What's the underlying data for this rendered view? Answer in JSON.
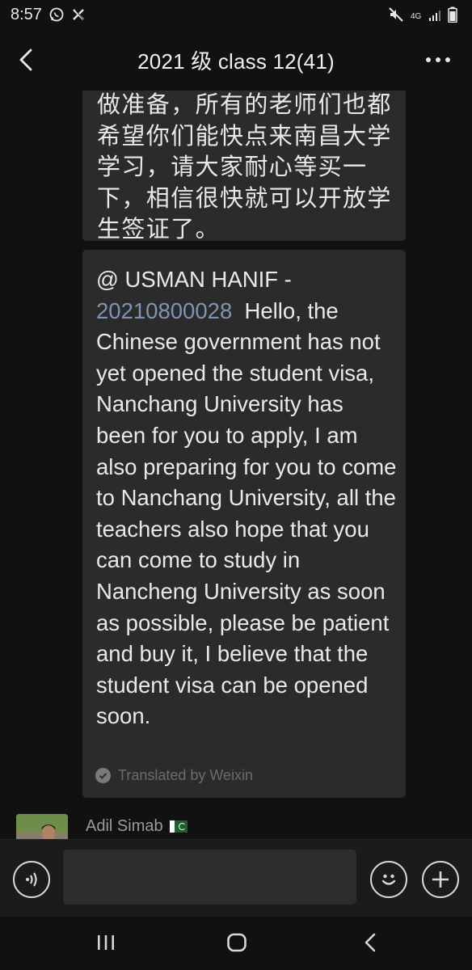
{
  "status_bar": {
    "time": "8:57",
    "network": "4G",
    "icons": [
      "whatsapp-icon",
      "x-icon",
      "mute-icon",
      "signal-icon",
      "battery-icon"
    ]
  },
  "header": {
    "title": "2021 级 class 12(41)",
    "back_icon": "chevron-left-icon",
    "more_icon": "more-dots-icon"
  },
  "messages": {
    "original_text": "做准备，所有的老师们也都希望你们能快点来南昌大学学习，请大家耐心等买一下，相信很快就可以开放学生签证了。",
    "translation": {
      "mention_name": "@ USMAN HANIF -",
      "mention_id": "20210800028",
      "text": "Hello, the Chinese government has not yet opened the student visa, Nanchang University has been for you to apply, I am also preparing for you to come to Nanchang University, all the teachers also hope that you can come to study in Nancheng University as soon as possible, please be patient and buy it, I believe that the student visa can be opened soon.",
      "credit": "Translated by Weixin"
    },
    "next_sender": {
      "name": "Adil Simab",
      "flag": "pakistan-flag-icon"
    }
  },
  "input_bar": {
    "placeholder": "",
    "voice_icon": "voice-icon",
    "emoji_icon": "emoji-icon",
    "plus_icon": "plus-icon"
  },
  "colors": {
    "background": "#111111",
    "bubble": "#2b2b2b",
    "mention_link": "#7d94b5",
    "muted_text": "#6b6b6b"
  }
}
